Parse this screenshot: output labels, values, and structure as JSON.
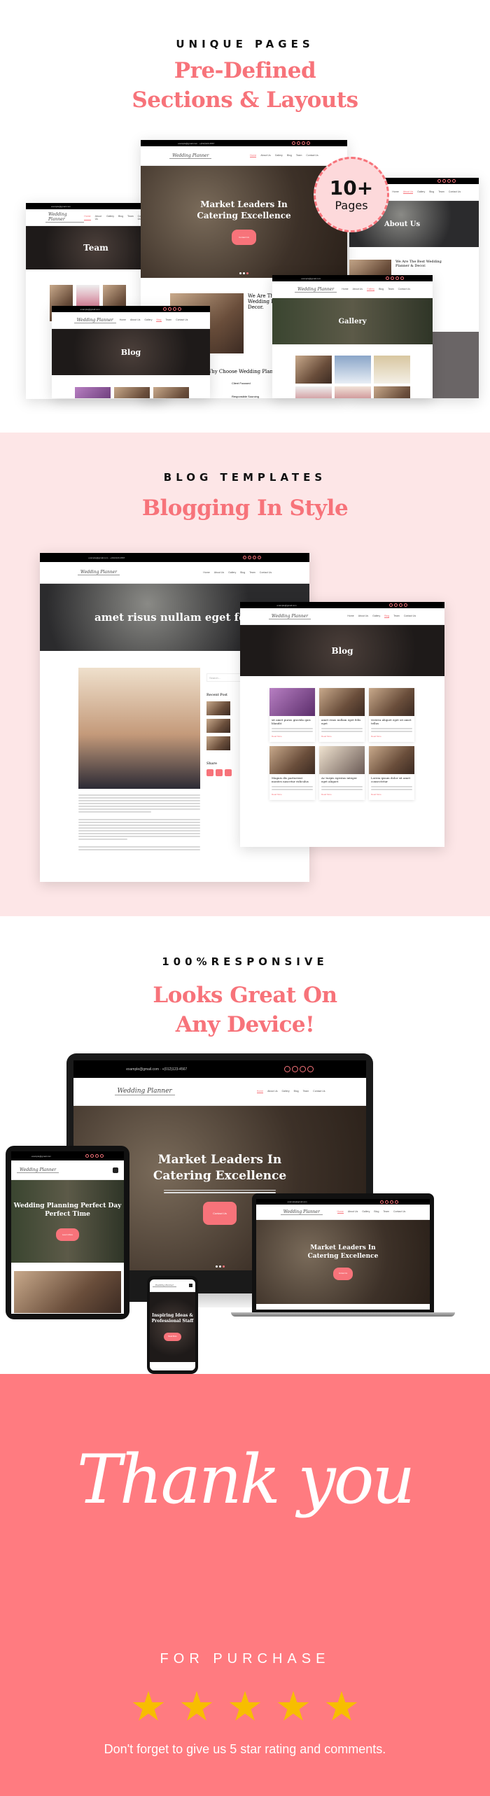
{
  "site": {
    "email": "example@gmail.com",
    "phone": "+(012)123-4567",
    "logo": "Wedding Planner",
    "nav": [
      "Home",
      "About Us",
      "Gallery",
      "Blog",
      "Team",
      "Contact Us"
    ],
    "button": "Contact Us",
    "read_more": "Read More"
  },
  "pages_section": {
    "kicker": "UNIQUE PAGES",
    "headline_1": "Pre-Defined",
    "headline_2": "Sections & Layouts",
    "badge_number": "10+",
    "badge_label": "Pages",
    "home_title_1": "Market Leaders In",
    "home_title_2": "Catering Excellence",
    "home_about": "We Are The Best Wedding Planner & Decor.",
    "home_why": "Why Choose Wedding Planner",
    "feature_1": "Client Focused",
    "feature_2": "Responsible Sourcing",
    "team_title": "Team",
    "about_title": "About Us",
    "about_heading": "We Are The Best Wedding Planner & Decor.",
    "blog_title": "Blog",
    "gallery_title": "Gallery"
  },
  "blog_section": {
    "kicker": "BLOG TEMPLATES",
    "headline": "Blogging In Style",
    "post_title": "amet risus nullam eget felis e",
    "search_placeholder": "Search...",
    "recent_post": "Recent Post",
    "share": "Share",
    "list_title": "Blog",
    "cards": [
      "sit amet purus gravida quis blandit",
      "amet risus nullam eget felis eget",
      "viverra aliquet eget sit amet tellus",
      "Magnis dis parturient montes nascetur ridiculus",
      "Ac turpis egestas integer eget aliquet",
      "Lorem ipsum dolor sit amet consectetur"
    ]
  },
  "responsive_section": {
    "kicker": "100%RESPONSIVE",
    "headline_1": "Looks Great On",
    "headline_2": "Any Device!",
    "desktop_title_1": "Market Leaders In",
    "desktop_title_2": "Catering Excellence",
    "tablet_title_1": "Wedding Planning Perfect Day",
    "tablet_title_2": "Perfect Time",
    "tablet_button": "Learn More",
    "phone_title_1": "Inspiring Ideas &",
    "phone_title_2": "Professional Staff",
    "phone_button": "Read More"
  },
  "thanks_section": {
    "script": "Thank you",
    "sub": "FOR PURCHASE",
    "rating": 5,
    "note": "Don't forget to give us 5 star rating and comments.",
    "bg_color": "#ff7b80",
    "star_color": "#f7be00"
  },
  "colors": {
    "accent": "#f7737a",
    "blog_bg": "#fde6e7"
  }
}
